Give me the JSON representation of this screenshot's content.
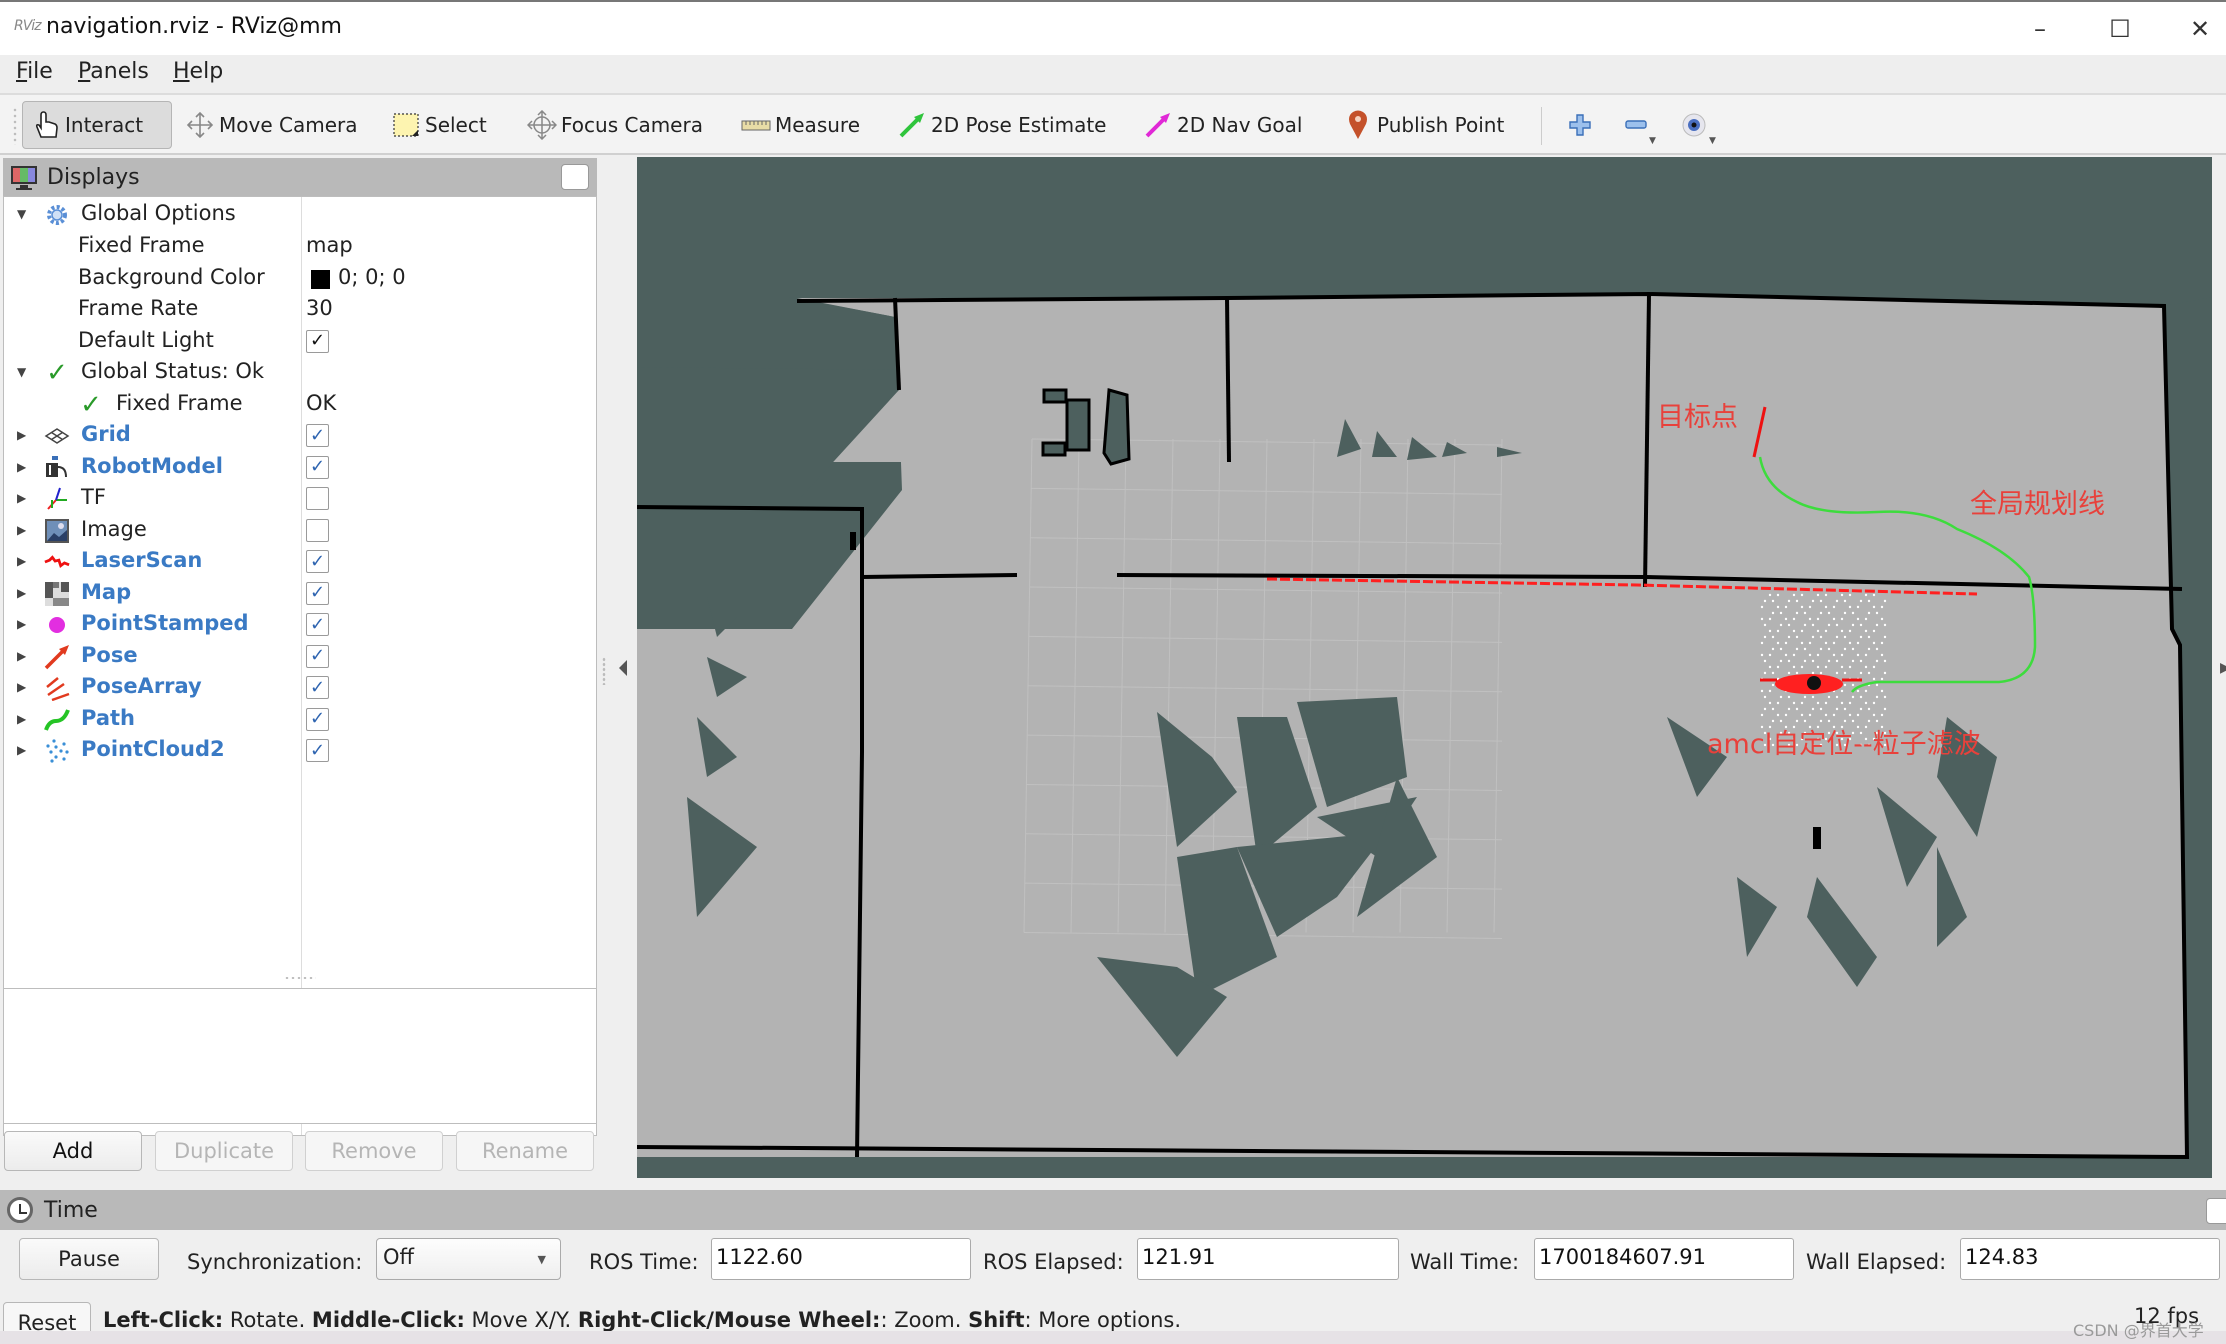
{
  "window": {
    "title": "navigation.rviz - RViz@mm",
    "app_icon_text": "RViz",
    "controls": {
      "minimize": "–",
      "maximize": "☐",
      "close": "✕"
    }
  },
  "menu": {
    "items": [
      {
        "label": "File",
        "mnemonic": "F",
        "rest": "ile"
      },
      {
        "label": "Panels",
        "mnemonic": "P",
        "rest": "anels"
      },
      {
        "label": "Help",
        "mnemonic": "H",
        "rest": "elp"
      }
    ]
  },
  "toolbar": {
    "tools": [
      {
        "label": "Interact",
        "icon": "hand-pointer-icon",
        "active": true
      },
      {
        "label": "Move Camera",
        "icon": "move-arrows-icon",
        "active": false
      },
      {
        "label": "Select",
        "icon": "select-box-icon",
        "active": false
      },
      {
        "label": "Focus Camera",
        "icon": "crosshair-icon",
        "active": false
      },
      {
        "label": "Measure",
        "icon": "ruler-icon",
        "active": false
      },
      {
        "label": "2D Pose Estimate",
        "icon": "green-arrow-icon",
        "active": false
      },
      {
        "label": "2D Nav Goal",
        "icon": "magenta-arrow-icon",
        "active": false
      },
      {
        "label": "Publish Point",
        "icon": "map-pin-icon",
        "active": false
      }
    ],
    "extra": [
      "add-tool-icon",
      "remove-tool-icon",
      "view-eye-icon"
    ]
  },
  "displays": {
    "title": "Displays",
    "tree": [
      {
        "label": "Global Options",
        "icon": "gear-icon",
        "expanded": true,
        "level": 0
      },
      {
        "label": "Fixed Frame",
        "value": "map",
        "level": 1
      },
      {
        "label": "Background Color",
        "value": "0; 0; 0",
        "swatch": "#000000",
        "level": 1
      },
      {
        "label": "Frame Rate",
        "value": "30",
        "level": 1
      },
      {
        "label": "Default Light",
        "checked": true,
        "level": 1
      },
      {
        "label": "Global Status: Ok",
        "icon": "check-icon",
        "expanded": true,
        "level": 0
      },
      {
        "label": "Fixed Frame",
        "value": "OK",
        "icon": "check-icon",
        "level": 1
      },
      {
        "label": "Grid",
        "icon": "grid-icon",
        "checked": true,
        "display": true
      },
      {
        "label": "RobotModel",
        "icon": "robot-model-icon",
        "checked": true,
        "display": true
      },
      {
        "label": "TF",
        "icon": "tf-axes-icon",
        "checked": false,
        "display": false
      },
      {
        "label": "Image",
        "icon": "image-icon",
        "checked": false,
        "display": false
      },
      {
        "label": "LaserScan",
        "icon": "laser-scan-icon",
        "checked": true,
        "display": true
      },
      {
        "label": "Map",
        "icon": "map-icon",
        "checked": true,
        "display": true
      },
      {
        "label": "PointStamped",
        "icon": "point-stamped-icon",
        "checked": true,
        "display": true
      },
      {
        "label": "Pose",
        "icon": "pose-arrow-icon",
        "checked": true,
        "display": true
      },
      {
        "label": "PoseArray",
        "icon": "pose-array-icon",
        "checked": true,
        "display": true
      },
      {
        "label": "Path",
        "icon": "path-icon",
        "checked": true,
        "display": true
      },
      {
        "label": "PointCloud2",
        "icon": "point-cloud-icon",
        "checked": true,
        "display": true
      }
    ],
    "buttons": {
      "add": "Add",
      "duplicate": "Duplicate",
      "remove": "Remove",
      "rename": "Rename"
    }
  },
  "viewport": {
    "annotations": {
      "goal": "目标点",
      "global_plan": "全局规划线",
      "amcl": "amcl自定位--粒子滤波"
    },
    "colors": {
      "unknown": "#4d605e",
      "free": "#b3b3b3",
      "wall": "#000000",
      "path": "#3ddc3d",
      "laser": "#ff2020",
      "annotation": "#e8413b"
    }
  },
  "time": {
    "title": "Time",
    "pause_label": "Pause",
    "sync_label": "Synchronization:",
    "sync_value": "Off",
    "ros_time_label": "ROS Time:",
    "ros_time": "1122.60",
    "ros_elapsed_label": "ROS Elapsed:",
    "ros_elapsed": "121.91",
    "wall_time_label": "Wall Time:",
    "wall_time": "1700184607.91",
    "wall_elapsed_label": "Wall Elapsed:",
    "wall_elapsed": "124.83"
  },
  "status": {
    "reset_label": "Reset",
    "parts": [
      {
        "key": "Left-Click:",
        "text": " Rotate. "
      },
      {
        "key": "Middle-Click:",
        "text": " Move X/Y. "
      },
      {
        "key": "Right-Click/Mouse Wheel:",
        "text": ": Zoom. "
      },
      {
        "key": "Shift",
        "text": ": More options."
      }
    ],
    "fps": "12 fps",
    "watermark": "CSDN @界首大学"
  }
}
